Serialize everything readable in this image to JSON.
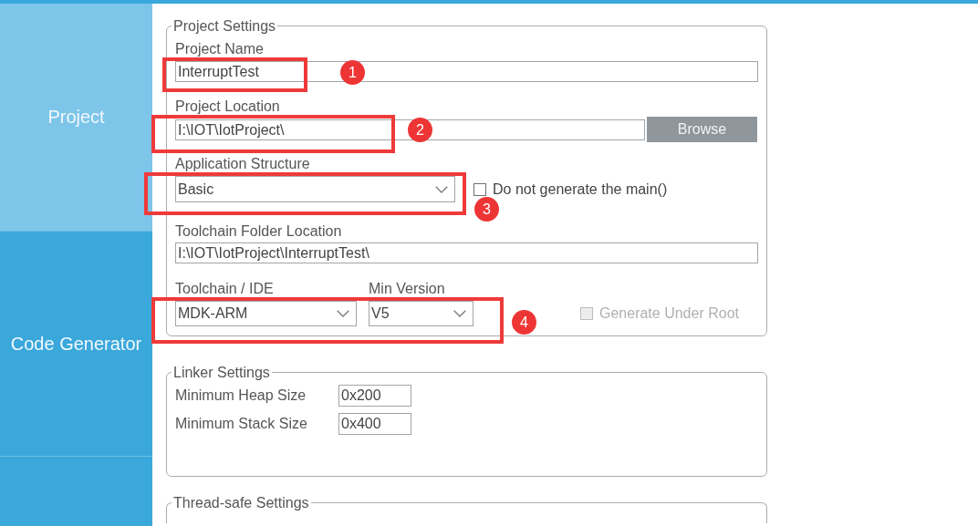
{
  "sidebar": {
    "items": [
      {
        "label": "Project",
        "selected": true
      },
      {
        "label": "Code Generator",
        "selected": false
      },
      {
        "selected": false
      }
    ]
  },
  "project_settings": {
    "legend": "Project Settings",
    "project_name": {
      "label": "Project Name",
      "value": "InterruptTest",
      "annotation": "1"
    },
    "project_location": {
      "label": "Project Location",
      "value": "I:\\IOT\\IotProject\\",
      "button": "Browse",
      "annotation": "2"
    },
    "application_structure": {
      "label": "Application Structure",
      "value": "Basic",
      "annotation": "3",
      "checkbox": {
        "label": "Do not generate the main()",
        "checked": false,
        "disabled": false
      }
    },
    "toolchain_folder_location": {
      "label": "Toolchain Folder Location",
      "value": "I:\\IOT\\IotProject\\InterruptTest\\"
    },
    "toolchain": {
      "annotation": "4",
      "ide": {
        "label": "Toolchain / IDE",
        "value": "MDK-ARM"
      },
      "min_version": {
        "label": "Min Version",
        "value": "V5"
      },
      "checkbox": {
        "label": "Generate Under Root",
        "checked": false,
        "disabled": true
      }
    }
  },
  "linker_settings": {
    "legend": "Linker Settings",
    "rows": [
      {
        "label": "Minimum Heap Size",
        "value": "0x200"
      },
      {
        "label": "Minimum Stack Size",
        "value": "0x400"
      }
    ]
  },
  "thread_safe_settings": {
    "legend": "Thread-safe Settings"
  }
}
